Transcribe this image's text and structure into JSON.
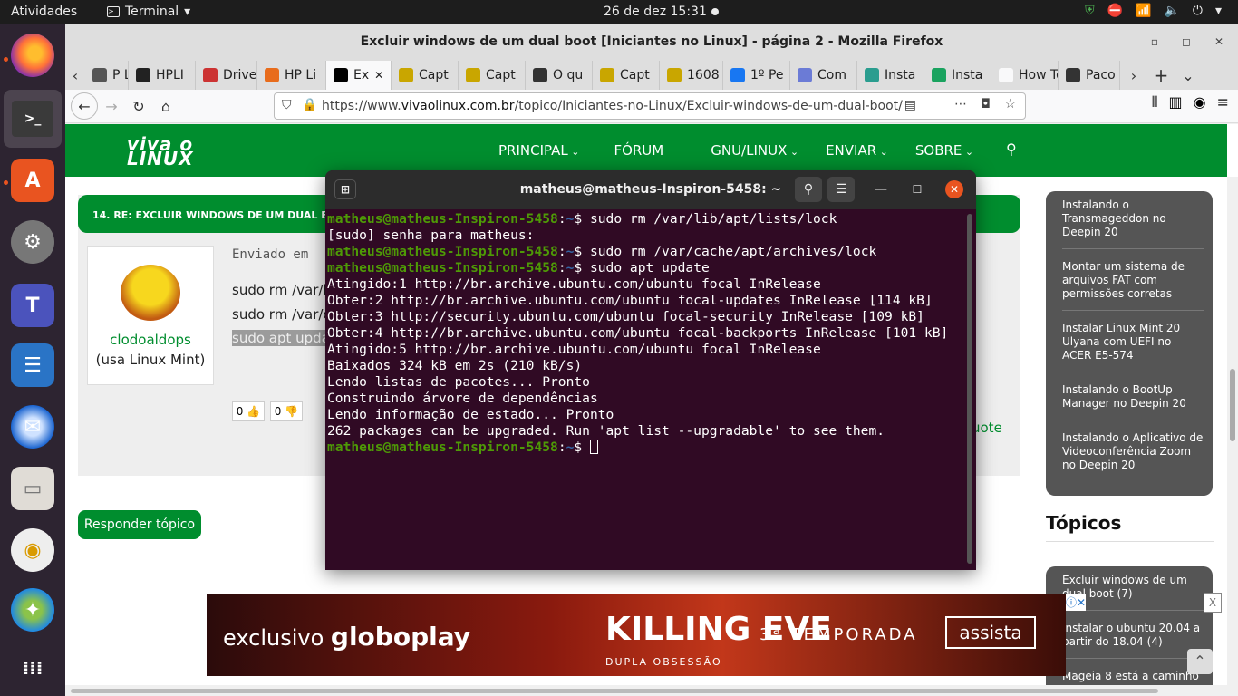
{
  "topbar": {
    "activities": "Atividades",
    "app": "Terminal",
    "clock": "26 de dez  15:31"
  },
  "firefox": {
    "title": "Excluir windows de um dual boot [Iniciantes no Linux] - página 2 - Mozilla Firefox",
    "tabs": [
      {
        "label": "P Li",
        "color": "#555"
      },
      {
        "label": "HPLI",
        "color": "#222"
      },
      {
        "label": "Drive",
        "color": "#c33"
      },
      {
        "label": "HP Li",
        "color": "#e86c1c"
      },
      {
        "label": "Ex",
        "color": "#000",
        "active": true
      },
      {
        "label": "Capt",
        "color": "#c9a600"
      },
      {
        "label": "Capt",
        "color": "#c9a600"
      },
      {
        "label": "O qu",
        "color": "#333"
      },
      {
        "label": "Capt",
        "color": "#c9a600"
      },
      {
        "label": "1608",
        "color": "#c9a600"
      },
      {
        "label": "1º Pe",
        "color": "#1877f2"
      },
      {
        "label": "Com",
        "color": "#6b7bd6"
      },
      {
        "label": "Insta",
        "color": "#2a9d8f"
      },
      {
        "label": "Insta",
        "color": "#1aa35f"
      },
      {
        "label": "How To",
        "color": "#f9f9fa"
      },
      {
        "label": "Paco",
        "color": "#333"
      }
    ],
    "url_prefix": "https://www.",
    "url_host": "vivaolinux.com.br",
    "url_path": "/topico/Iniciantes-no-Linux/Excluir-windows-de-um-dual-boot/"
  },
  "site": {
    "logo_top": "viva o",
    "logo_bottom": "LINUX",
    "nav": [
      "PRINCIPAL",
      "FÓRUM",
      "GNU/LINUX",
      "ENVIAR",
      "SOBRE"
    ],
    "post_heading": "14. RE: EXCLUIR WINDOWS DE UM DUAL B",
    "sent": "Enviado em",
    "lines": [
      "sudo rm /var/l",
      "sudo rm /var/c",
      "sudo apt upda"
    ],
    "user": "clodoaldops",
    "user_os": "(usa Linux Mint)",
    "vote_up": "0",
    "vote_down": "0",
    "quote": "uote",
    "reply": "Responder tópico",
    "sidebar": [
      "Instalando o Transmageddon no Deepin 20",
      "Montar um sistema de arquivos FAT com permissões corretas",
      "Instalar Linux Mint 20 Ulyana com UEFI no ACER E5-574",
      "Instalando o BootUp Manager no Deepin 20",
      "Instalando o Aplicativo de Videoconferência Zoom no Deepin 20"
    ],
    "topicos_title": "Tópicos",
    "topicos": [
      "Excluir windows de um dual boot (7)",
      "Instalar o ubuntu 20.04 a partir do 18.04 (4)",
      "Mageia 8 está a caminho"
    ]
  },
  "ad": {
    "exclusivo": "exclusivo",
    "brand": "globoplay",
    "show": "KILLING EVE",
    "subtitle": "DUPLA OBSESSÃO",
    "season": "3ª TEMPORADA",
    "cta": "assista",
    "close": "X"
  },
  "terminal": {
    "title": "matheus@matheus-Inspiron-5458: ~",
    "user": "matheus@matheus-Inspiron-5458",
    "path": "~",
    "lines": [
      {
        "prompt": true,
        "cmd": "sudo rm /var/lib/apt/lists/lock"
      },
      {
        "text": "[sudo] senha para matheus:"
      },
      {
        "prompt": true,
        "cmd": "sudo rm /var/cache/apt/archives/lock"
      },
      {
        "prompt": true,
        "cmd": "sudo apt update"
      },
      {
        "text": "Atingido:1 http://br.archive.ubuntu.com/ubuntu focal InRelease"
      },
      {
        "text": "Obter:2 http://br.archive.ubuntu.com/ubuntu focal-updates InRelease [114 kB]"
      },
      {
        "text": "Obter:3 http://security.ubuntu.com/ubuntu focal-security InRelease [109 kB]"
      },
      {
        "text": "Obter:4 http://br.archive.ubuntu.com/ubuntu focal-backports InRelease [101 kB]"
      },
      {
        "text": "Atingido:5 http://br.archive.ubuntu.com/ubuntu focal InRelease"
      },
      {
        "text": "Baixados 324 kB em 2s (210 kB/s)"
      },
      {
        "text": "Lendo listas de pacotes... Pronto"
      },
      {
        "text": "Construindo árvore de dependências"
      },
      {
        "text": "Lendo informação de estado... Pronto"
      },
      {
        "text": "262 packages can be upgraded. Run 'apt list --upgradable' to see them."
      },
      {
        "prompt": true,
        "cmd": "",
        "cursor": true
      }
    ]
  }
}
